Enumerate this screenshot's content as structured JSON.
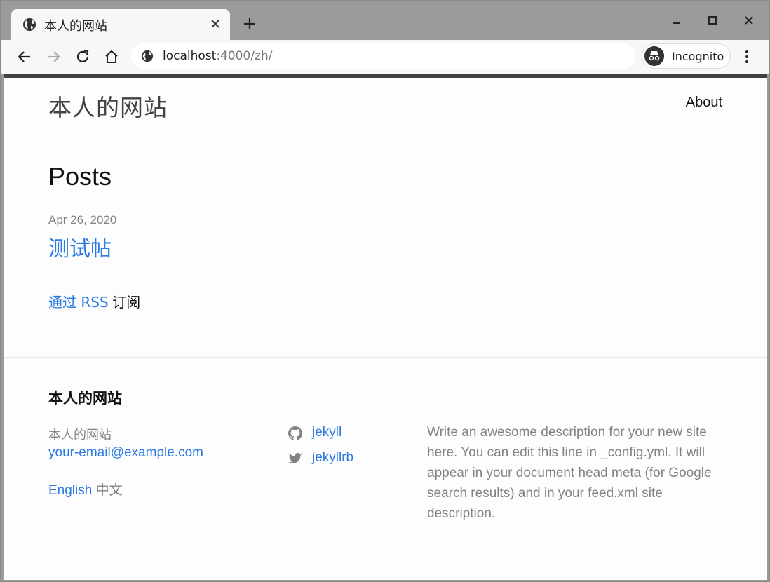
{
  "browser": {
    "tab_title": "本人的网站",
    "url_host": "localhost",
    "url_path": ":4000/zh/",
    "incognito_label": "Incognito"
  },
  "icons": {
    "tab_favicon": "globe-icon",
    "tab_close": "close-icon",
    "new_tab": "plus-icon",
    "minimize": "minimize-icon",
    "maximize": "maximize-icon",
    "close_window": "close-icon",
    "back": "back-arrow-icon",
    "forward": "forward-arrow-icon",
    "reload": "reload-icon",
    "home": "home-icon",
    "site_info": "globe-icon",
    "incognito": "incognito-icon",
    "menu": "kebab-menu-icon",
    "github": "github-icon",
    "twitter": "twitter-icon"
  },
  "colors": {
    "link": "#2a7ae2",
    "muted": "#828282",
    "header_border": "#424242"
  },
  "header": {
    "site_title": "本人的网站",
    "nav_about": "About"
  },
  "main": {
    "heading": "Posts",
    "posts": [
      {
        "date": "Apr 26, 2020",
        "title": "测试帖"
      }
    ],
    "rss_link": "通过 RSS",
    "rss_suffix": "订阅"
  },
  "footer": {
    "heading": "本人的网站",
    "name": "本人的网站",
    "email": "your-email@example.com",
    "lang_en": "English",
    "lang_zh": "中文",
    "social": [
      {
        "icon": "github-icon",
        "label": "jekyll"
      },
      {
        "icon": "twitter-icon",
        "label": "jekyllrb"
      }
    ],
    "description": "Write an awesome description for your new site here. You can edit this line in _config.yml. It will appear in your document head meta (for Google search results) and in your feed.xml site description."
  }
}
